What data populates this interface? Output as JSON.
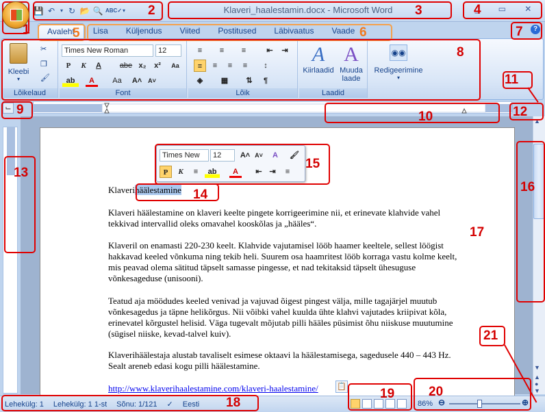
{
  "window": {
    "title": "Klaveri_haalestamin.docx - Microsoft Word",
    "controls": [
      "_",
      "▭",
      "✕"
    ]
  },
  "quick_access": {
    "icons": [
      "save-icon",
      "undo-icon",
      "redo-icon",
      "open-icon",
      "print-preview-icon",
      "spelling-icon",
      "customize-icon"
    ]
  },
  "tabs": [
    "Avaleht",
    "Lisa",
    "Küljendus",
    "Viited",
    "Postitused",
    "Läbivaatus",
    "Vaade"
  ],
  "active_tab": "Avaleht",
  "ribbon": {
    "clipboard": {
      "label": "Lõikelaud",
      "paste": "Kleebi"
    },
    "font": {
      "label": "Font",
      "family": "Times New Roman",
      "size": "12",
      "bold": "P",
      "italic": "K",
      "underline": "A",
      "strike": "abe",
      "sub": "x₂",
      "sup": "x²",
      "aa": "Aa"
    },
    "paragraph": {
      "label": "Lõik"
    },
    "styles": {
      "label": "Laadid",
      "quick": "Kiirlaadid",
      "change": "Muuda laade"
    },
    "editing": {
      "label": "Redigeerimine"
    }
  },
  "mini_toolbar": {
    "font": "Times New",
    "size": "12",
    "bold": "P",
    "italic": "K"
  },
  "document": {
    "heading_plain": "Klaveri",
    "heading_selected": "häälestamine",
    "paragraphs": [
      "Klaveri häälestamine on klaveri keelte pingete korrigeerimine nii, et erinevate klahvide vahel tekkivad intervallid oleks omavahel kooskõlas ja „hääles“.",
      "Klaveril on enamasti 220-230 keelt. Klahvide vajutamisel lööb haamer keeltele, sellest löögist hakkavad keeled võnkuma ning tekib heli. Suurem osa haamritest lööb korraga vastu kolme keelt, mis peavad olema sätitud täpselt samasse pingesse, et nad tekitaksid täpselt ühesuguse võnkesageduse (unisooni).",
      "Teatud aja möödudes keeled venivad ja vajuvad õigest pingest välja, mille tagajärjel muutub võnkesagedus ja täpne helikõrgus. Nii võibki vahel kuulda ühte klahvi vajutades kriipivat kõla, erinevatel kõrgustel helisid. Väga tugevalt mõjutab pilli hääles püsimist õhu niiskuse muutumine (sügisel niiske, kevad-talvel kuiv).",
      "Klaverihäälestaja alustab tavaliselt esimese oktaavi la häälestamisega, sagedusele 440 – 443 Hz. Sealt areneb edasi kogu pilli häälestamine."
    ],
    "link": "http://www.klaverihaalestamine.com/klaveri-haalestamine/"
  },
  "status": {
    "page": "Lehekülg: 1",
    "section": "Lehekülg: 1 1-st",
    "words": "Sõnu: 1/121",
    "language": "Eesti",
    "zoom": "86%",
    "zoom_level_percent": 86
  },
  "callouts": [
    "1",
    "2",
    "3",
    "4",
    "5",
    "6",
    "7",
    "8",
    "9",
    "10",
    "11",
    "12",
    "13",
    "14",
    "15",
    "16",
    "17",
    "18",
    "19",
    "20",
    "21"
  ],
  "colors": {
    "callout": "#e00000",
    "callout_orange": "#f5a04a",
    "selection": "#aac8ee"
  }
}
